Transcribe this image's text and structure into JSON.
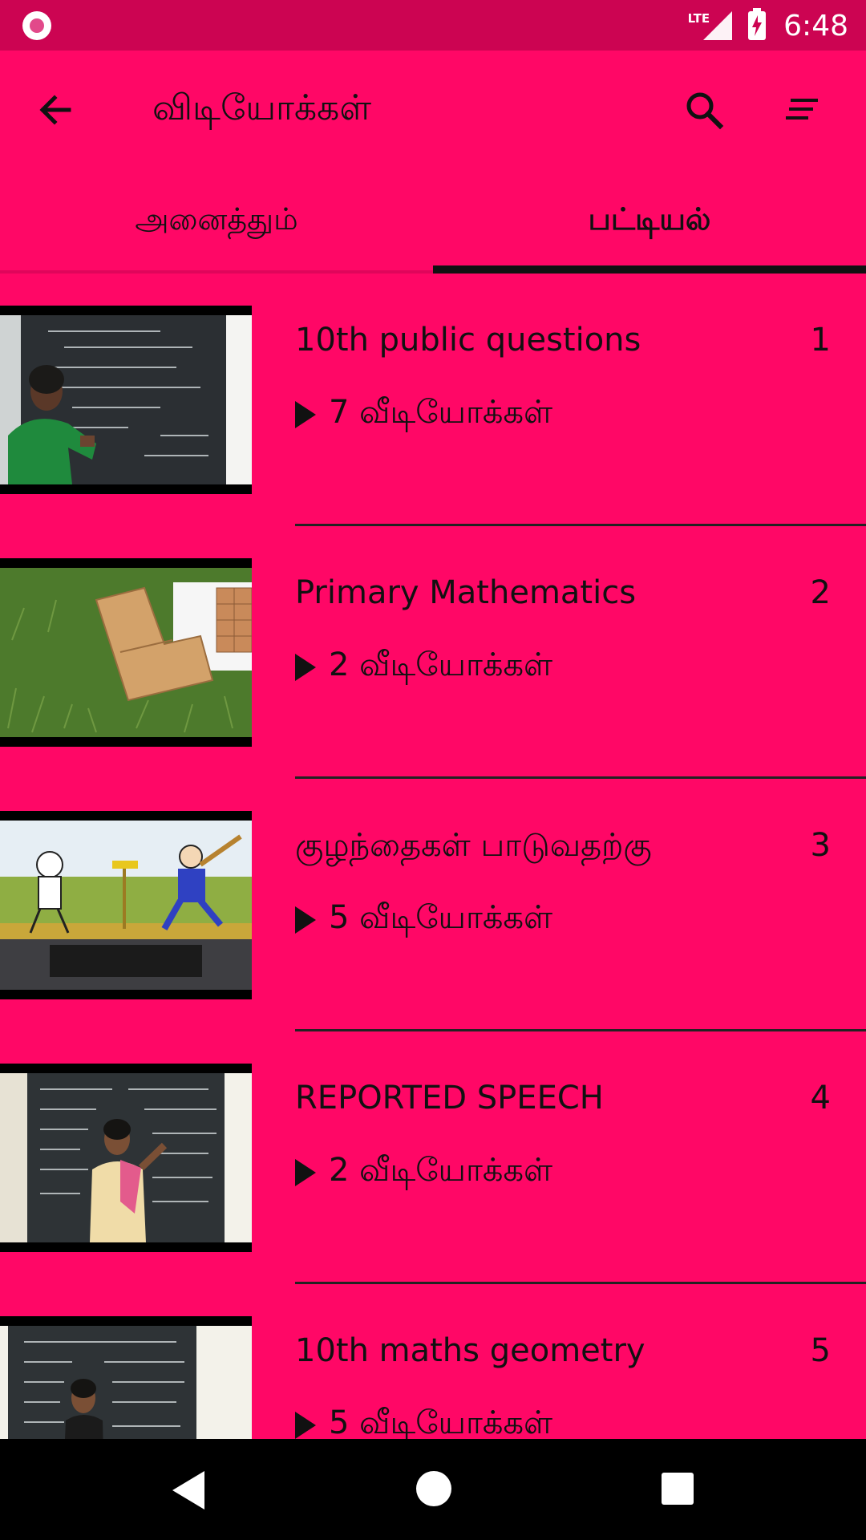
{
  "status_bar": {
    "network": "LTE",
    "time": "6:48"
  },
  "app_bar": {
    "title": "விடியோக்கள்"
  },
  "tabs": [
    {
      "label": "அனைத்தும்",
      "selected": false
    },
    {
      "label": "பட்டியல்",
      "selected": true
    }
  ],
  "playlists": [
    {
      "title": "10th public questions",
      "index": "1",
      "count": "7 வீடியோக்கள்"
    },
    {
      "title": "Primary Mathematics",
      "index": "2",
      "count": "2 வீடியோக்கள்"
    },
    {
      "title": "குழந்தைகள் பாடுவதற்கு",
      "index": "3",
      "count": "5 வீடியோக்கள்"
    },
    {
      "title": "REPORTED SPEECH",
      "index": "4",
      "count": "2 வீடியோக்கள்"
    },
    {
      "title": "10th maths geometry",
      "index": "5",
      "count": "5 வீடியோக்கள்"
    }
  ],
  "colors": {
    "primary": "#ff0766",
    "status_bar": "#cc0452",
    "indicator": "#111111"
  },
  "icons": [
    "back-arrow-icon",
    "search-icon",
    "sort-icon",
    "play-icon"
  ]
}
